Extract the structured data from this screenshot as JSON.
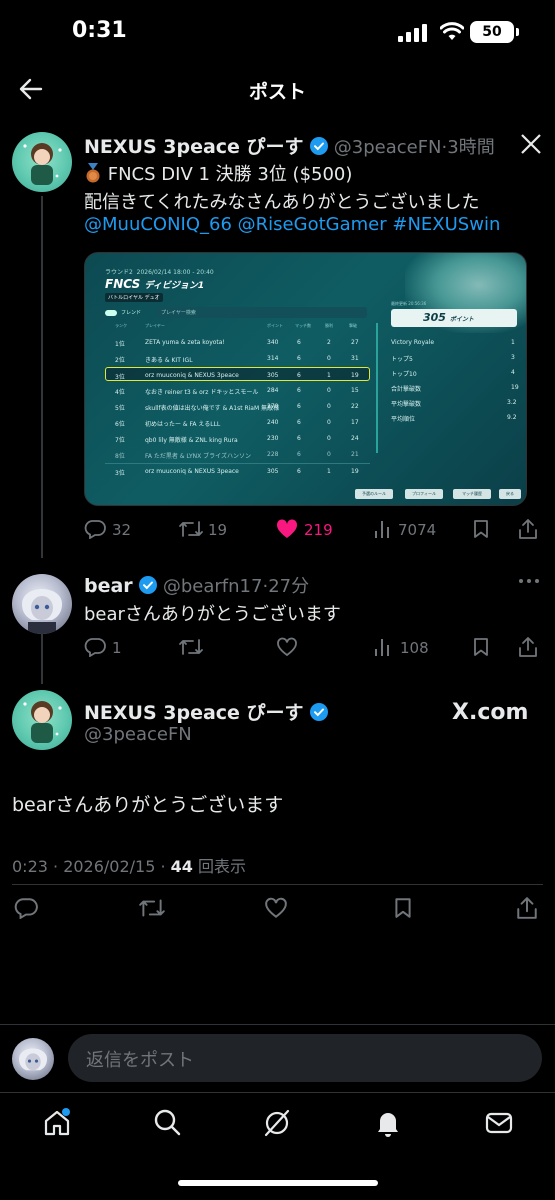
{
  "status_bar": {
    "time": "0:31",
    "battery": "50"
  },
  "header": {
    "title": "ポスト"
  },
  "main_post": {
    "display_name": "NEXUS 3peace ぴーす",
    "handle": "@3peaceFN",
    "time_ago": "3時間",
    "line1": "FNCS DIV 1 決勝 3位 ($500)",
    "line2": "配信きてくれたみなさんありがとうございました",
    "mentions": [
      "@MuuCONIQ_66",
      "@RiseGotGamer",
      "#NEXUSwin"
    ],
    "stats": {
      "replies": "32",
      "reposts": "19",
      "likes": "219",
      "views": "7074"
    },
    "like_color": "#f91880",
    "media": {
      "round": "ラウンド2",
      "datetime": "2026/02/14 18:00 - 20:40",
      "event": "FNCS",
      "division": "ディビジョン1",
      "mode": "バトルロイヤル",
      "mode_tag": "デュオ",
      "friend_label": "フレンド",
      "search_placeholder": "プレイヤー検索",
      "columns": [
        "ランク",
        "プレイヤー",
        "ポイント",
        "マッチ数",
        "勝利",
        "撃破"
      ],
      "rows": [
        [
          "1位",
          "ZETA yuma & zeta koyota!",
          "340",
          "6",
          "2",
          "27"
        ],
        [
          "2位",
          "きある & KIT IGL",
          "314",
          "6",
          "0",
          "31"
        ],
        [
          "3位",
          "orz muuconiq & NEXUS 3peace",
          "305",
          "6",
          "1",
          "19"
        ],
        [
          "4位",
          "なおき reiner t3 & orz ドキッとスモール",
          "284",
          "6",
          "0",
          "15"
        ],
        [
          "5位",
          "skullf表の値は出ない俺です & A1st RiaM 無敵様",
          "270",
          "6",
          "0",
          "22"
        ],
        [
          "6位",
          "初めはったー & FA えるLLL",
          "240",
          "6",
          "0",
          "17"
        ],
        [
          "7位",
          "qb0 lily 無敵様 & ZNL king Rura",
          "230",
          "6",
          "0",
          "24"
        ],
        [
          "8位",
          "FA ただ黒者 & LYNX ブライズハンソン",
          "228",
          "6",
          "0",
          "21"
        ]
      ],
      "own_row": [
        "3位",
        "orz muuconiq & NEXUS 3peace",
        "305",
        "6",
        "1",
        "19"
      ],
      "updated": "最終更新 20:56:36",
      "points_big": "305",
      "points_label": "ポイント",
      "summary": [
        [
          "Victory Royale",
          "1"
        ],
        [
          "トップ5",
          "3"
        ],
        [
          "トップ10",
          "4"
        ],
        [
          "合計撃破数",
          "19"
        ],
        [
          "平均撃破数",
          "3.2"
        ],
        [
          "平均順位",
          "9.2"
        ]
      ],
      "buttons": [
        "予選のルール",
        "プロフィール",
        "マッチ履歴",
        "戻る"
      ]
    }
  },
  "reply_post": {
    "display_name": "bear",
    "handle": "@bearfn17",
    "time_ago": "27分",
    "text": "bearさんありがとうございます",
    "stats": {
      "replies": "1",
      "views": "108"
    }
  },
  "focused_post": {
    "display_name": "NEXUS 3peace ぴーす",
    "handle": "@3peaceFN",
    "source": "X.com",
    "text": "bearさんありがとうございます",
    "timestamp": "0:23 · 2026/02/15 · ",
    "views_count": "44",
    "views_label": " 回表示"
  },
  "reply_box": {
    "placeholder": "返信をポスト"
  },
  "colors": {
    "accent": "#1d9bf0",
    "verified": "#1d9bf0",
    "like": "#f91880"
  }
}
